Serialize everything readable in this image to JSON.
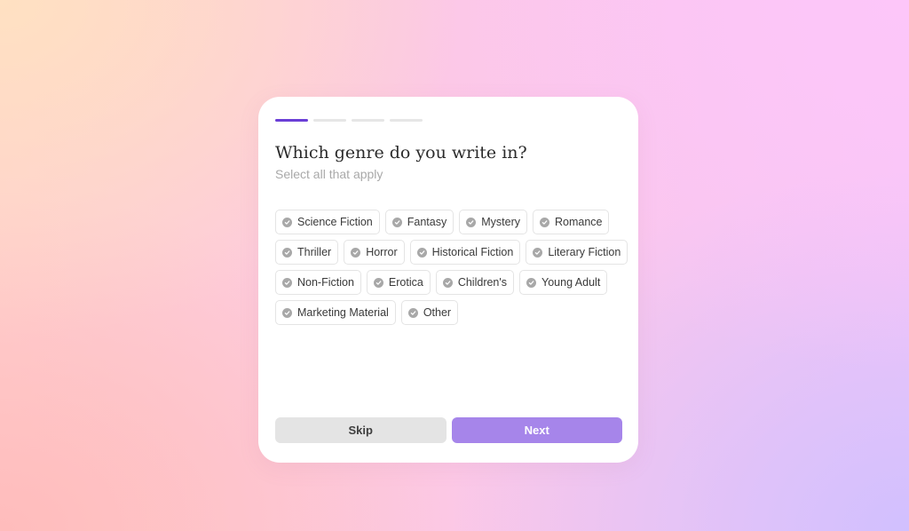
{
  "onboarding": {
    "progress": {
      "total_steps": 4,
      "current_step": 1
    },
    "title": "Which genre do you write in?",
    "subtitle": "Select all that apply",
    "chips": [
      {
        "label": "Science Fiction",
        "icon": "check-circle-icon"
      },
      {
        "label": "Fantasy",
        "icon": "check-circle-icon"
      },
      {
        "label": "Mystery",
        "icon": "check-circle-icon"
      },
      {
        "label": "Romance",
        "icon": "check-circle-icon"
      },
      {
        "label": "Thriller",
        "icon": "check-circle-icon"
      },
      {
        "label": "Horror",
        "icon": "check-circle-icon"
      },
      {
        "label": "Historical Fiction",
        "icon": "check-circle-icon"
      },
      {
        "label": "Literary Fiction",
        "icon": "check-circle-icon"
      },
      {
        "label": "Non-Fiction",
        "icon": "check-circle-icon"
      },
      {
        "label": "Erotica",
        "icon": "check-circle-icon"
      },
      {
        "label": "Children's",
        "icon": "check-circle-icon"
      },
      {
        "label": "Young Adult",
        "icon": "check-circle-icon"
      },
      {
        "label": "Marketing Material",
        "icon": "check-circle-icon"
      },
      {
        "label": "Other",
        "icon": "check-circle-icon"
      }
    ],
    "skip_label": "Skip",
    "next_label": "Next"
  },
  "colors": {
    "accent": "#6b3fd6",
    "next_button": "#a685ea",
    "skip_button": "#e4e4e4",
    "check_icon": "#a8a8a8"
  }
}
